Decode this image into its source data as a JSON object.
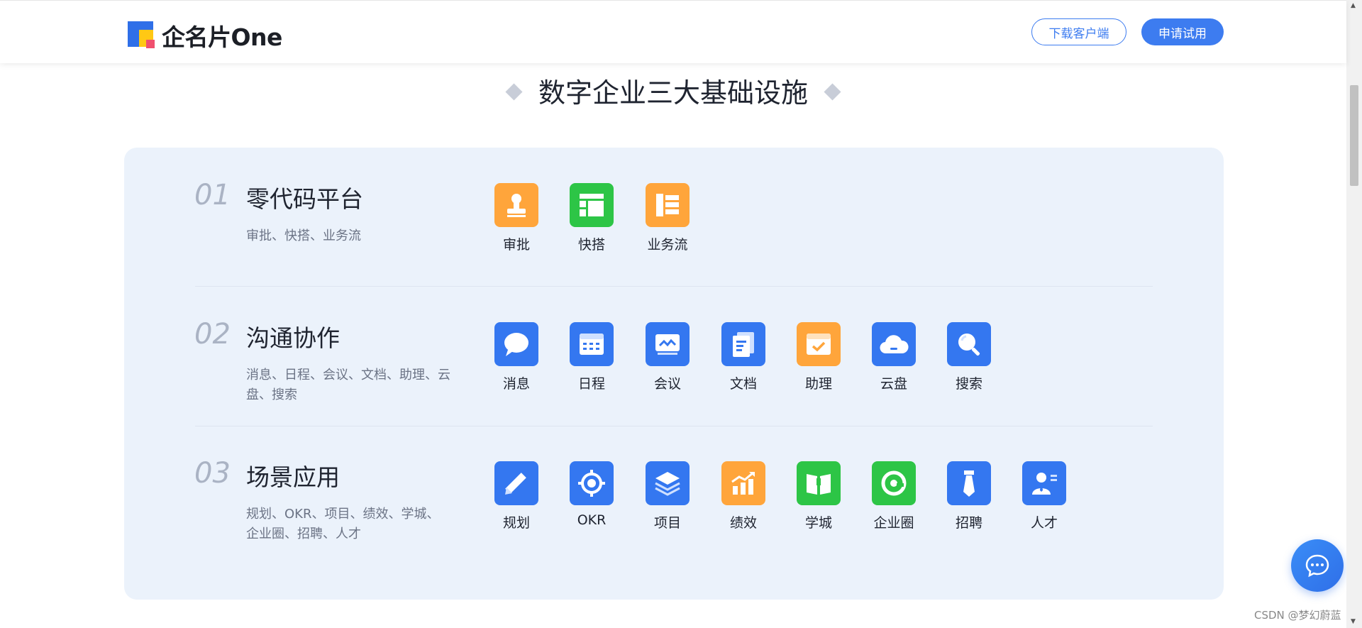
{
  "header": {
    "brand": "企名片One",
    "download_label": "下载客户端",
    "trial_label": "申请试用"
  },
  "section": {
    "title": "数字企业三大基础设施"
  },
  "rows": [
    {
      "number": "01",
      "title": "零代码平台",
      "desc": "审批、快搭、业务流",
      "apps": [
        {
          "label": "审批",
          "icon": "stamp-icon",
          "color": "#ffa53b"
        },
        {
          "label": "快搭",
          "icon": "layout-icon",
          "color": "#2dc546"
        },
        {
          "label": "业务流",
          "icon": "workflow-icon",
          "color": "#ffa53b"
        }
      ]
    },
    {
      "number": "02",
      "title": "沟通协作",
      "desc": "消息、日程、会议、文档、助理、云盘、搜索",
      "apps": [
        {
          "label": "消息",
          "icon": "chat-bubble-icon",
          "color": "#3477f0"
        },
        {
          "label": "日程",
          "icon": "calendar-icon",
          "color": "#3477f0"
        },
        {
          "label": "会议",
          "icon": "meeting-screen-icon",
          "color": "#3477f0"
        },
        {
          "label": "文档",
          "icon": "document-icon",
          "color": "#3477f0"
        },
        {
          "label": "助理",
          "icon": "assistant-check-icon",
          "color": "#ffa53b"
        },
        {
          "label": "云盘",
          "icon": "cloud-icon",
          "color": "#3477f0"
        },
        {
          "label": "搜索",
          "icon": "search-icon",
          "color": "#3477f0"
        }
      ]
    },
    {
      "number": "03",
      "title": "场景应用",
      "desc": "规划、OKR、项目、绩效、学城、企业圈、招聘、人才",
      "apps": [
        {
          "label": "规划",
          "icon": "pencil-icon",
          "color": "#3477f0"
        },
        {
          "label": "OKR",
          "icon": "target-icon",
          "color": "#3477f0"
        },
        {
          "label": "项目",
          "icon": "layers-icon",
          "color": "#3477f0"
        },
        {
          "label": "绩效",
          "icon": "growth-chart-icon",
          "color": "#ffa53b"
        },
        {
          "label": "学城",
          "icon": "book-icon",
          "color": "#2dc546"
        },
        {
          "label": "企业圈",
          "icon": "circle-refresh-icon",
          "color": "#2dc546"
        },
        {
          "label": "招聘",
          "icon": "necktie-icon",
          "color": "#3477f0"
        },
        {
          "label": "人才",
          "icon": "person-card-icon",
          "color": "#3477f0"
        }
      ]
    }
  ],
  "watermark": "CSDN @梦幻蔚蓝"
}
